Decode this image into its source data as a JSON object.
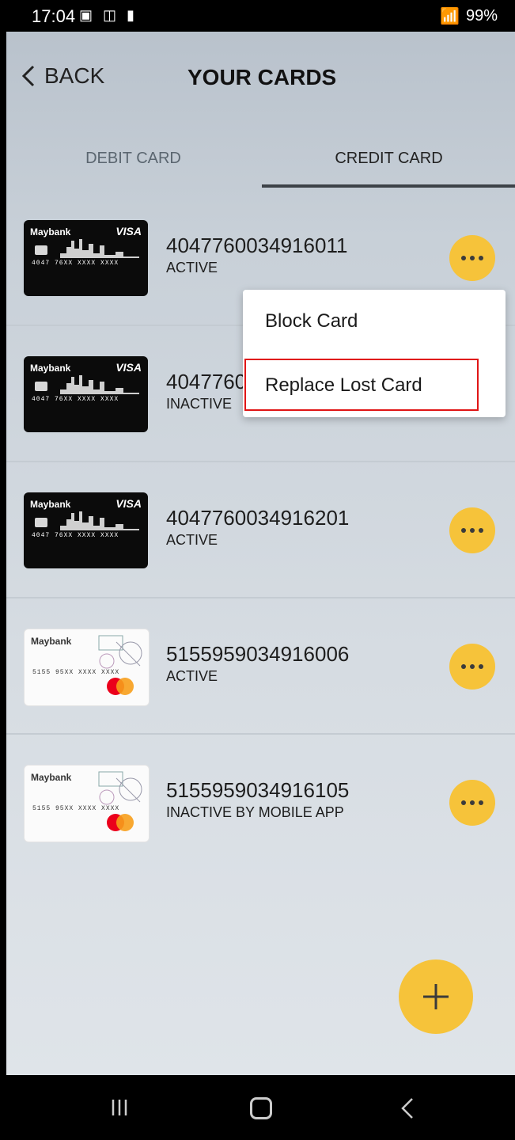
{
  "status_bar": {
    "time": "17:04",
    "battery": "99%"
  },
  "header": {
    "back_label": "BACK",
    "title": "YOUR CARDS"
  },
  "tabs": [
    {
      "label": "DEBIT CARD",
      "selected": false
    },
    {
      "label": "CREDIT CARD",
      "selected": true
    }
  ],
  "cards": [
    {
      "number": "4047760034916011",
      "status": "ACTIVE",
      "style": "visa-infinite-black",
      "card_brand": "Maybank",
      "network": "VISA",
      "masked": "4047 76XX XXXX XXXX"
    },
    {
      "number": "4047760",
      "status": "INACTIVE",
      "style": "visa-infinite-black",
      "card_brand": "Maybank",
      "network": "VISA",
      "masked": "4047 76XX XXXX XXXX"
    },
    {
      "number": "4047760034916201",
      "status": "ACTIVE",
      "style": "visa-infinite-black",
      "card_brand": "Maybank",
      "network": "VISA",
      "masked": "4047 76XX XXXX XXXX"
    },
    {
      "number": "5155959034916006",
      "status": "ACTIVE",
      "style": "mastercard-white",
      "card_brand": "Maybank",
      "network": "mastercard",
      "masked": "5155 95XX XXXX XXXX"
    },
    {
      "number": "5155959034916105",
      "status": "INACTIVE BY MOBILE APP",
      "style": "mastercard-white",
      "card_brand": "Maybank",
      "network": "mastercard",
      "masked": "5155 95XX XXXX XXXX"
    }
  ],
  "context_menu": {
    "items": [
      {
        "label": "Block Card"
      },
      {
        "label": "Replace Lost Card",
        "highlighted": true
      }
    ]
  },
  "colors": {
    "accent": "#f6c33a",
    "highlight_border": "#e01515"
  }
}
